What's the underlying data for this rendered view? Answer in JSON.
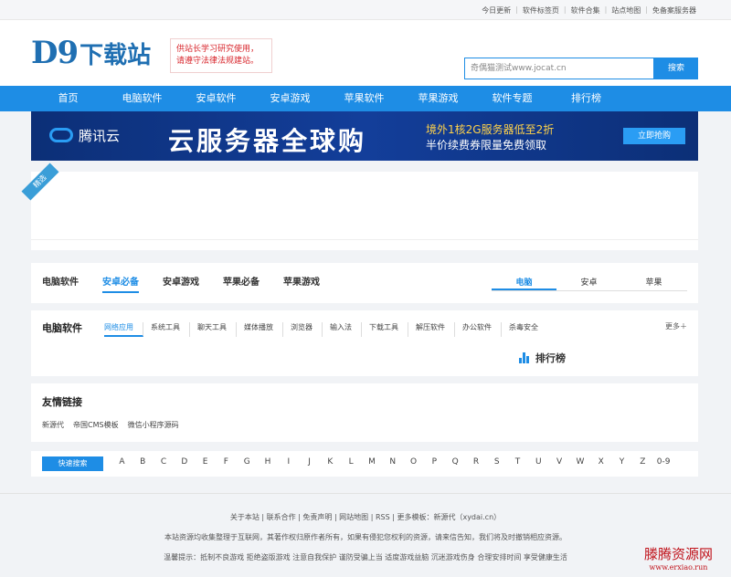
{
  "top_links": [
    "今日更新",
    "软件标签页",
    "软件合集",
    "站点地图",
    "免备案服务器"
  ],
  "logo": {
    "text": "D9",
    "sub": "下载站"
  },
  "notice": {
    "line1": "供站长学习研究使用，",
    "line2": "请遵守法律法规建站。"
  },
  "search": {
    "value": "奇偶猫测试www.jocat.cn",
    "button": "搜索"
  },
  "nav": [
    "首页",
    "电脑软件",
    "安卓软件",
    "安卓游戏",
    "苹果软件",
    "苹果游戏",
    "软件专题",
    "排行榜"
  ],
  "banner": {
    "brand": "腾讯云",
    "title": "云服务器全球购",
    "line1": "境外1核2G服务器低至2折",
    "line2": "半价续费券限量免费领取",
    "button": "立即抢购"
  },
  "featured_ribbon": "精选",
  "software_tabs": [
    "电脑软件",
    "安卓必备",
    "安卓游戏",
    "苹果必备",
    "苹果游戏"
  ],
  "software_tabs_active": "安卓必备",
  "platform_tabs": [
    "电脑",
    "安卓",
    "苹果"
  ],
  "pc_section": {
    "title": "电脑软件",
    "categories": [
      "网络应用",
      "系统工具",
      "聊天工具",
      "媒体播放",
      "浏览器",
      "输入法",
      "下载工具",
      "解压软件",
      "办公软件",
      "杀毒安全"
    ],
    "more": "更多＋",
    "ranking": "排行榜"
  },
  "friends": {
    "title": "友情链接",
    "links": [
      "新源代",
      "帝国CMS模板",
      "微信小程序源码"
    ]
  },
  "quick_search": {
    "button": "快速搜索",
    "letters": [
      "A",
      "B",
      "C",
      "D",
      "E",
      "F",
      "G",
      "H",
      "I",
      "J",
      "K",
      "L",
      "M",
      "N",
      "O",
      "P",
      "Q",
      "R",
      "S",
      "T",
      "U",
      "V",
      "W",
      "X",
      "Y",
      "Z",
      "0-9"
    ]
  },
  "footer": {
    "links": "关于本站 | 联系合作 | 免责声明 | 网站地图 | RSS | 更多模板：新源代（xydai.cn）",
    "copy": "本站资源均收集整理于互联网，其著作权归原作者所有，如果有侵犯您权利的资源，请来信告知，我们将及时撤销相应资源。",
    "tip": "温馨提示：抵制不良游戏 拒绝盗版游戏 注意自我保护 谨防受骗上当 适度游戏益脑 沉迷游戏伤身 合理安排时间 享受健康生活"
  },
  "watermark": {
    "big": "滕腾资源网",
    "small": "www.erxiao.run"
  },
  "colors": {
    "accent": "#1e8de5",
    "notice": "#d8262c"
  }
}
